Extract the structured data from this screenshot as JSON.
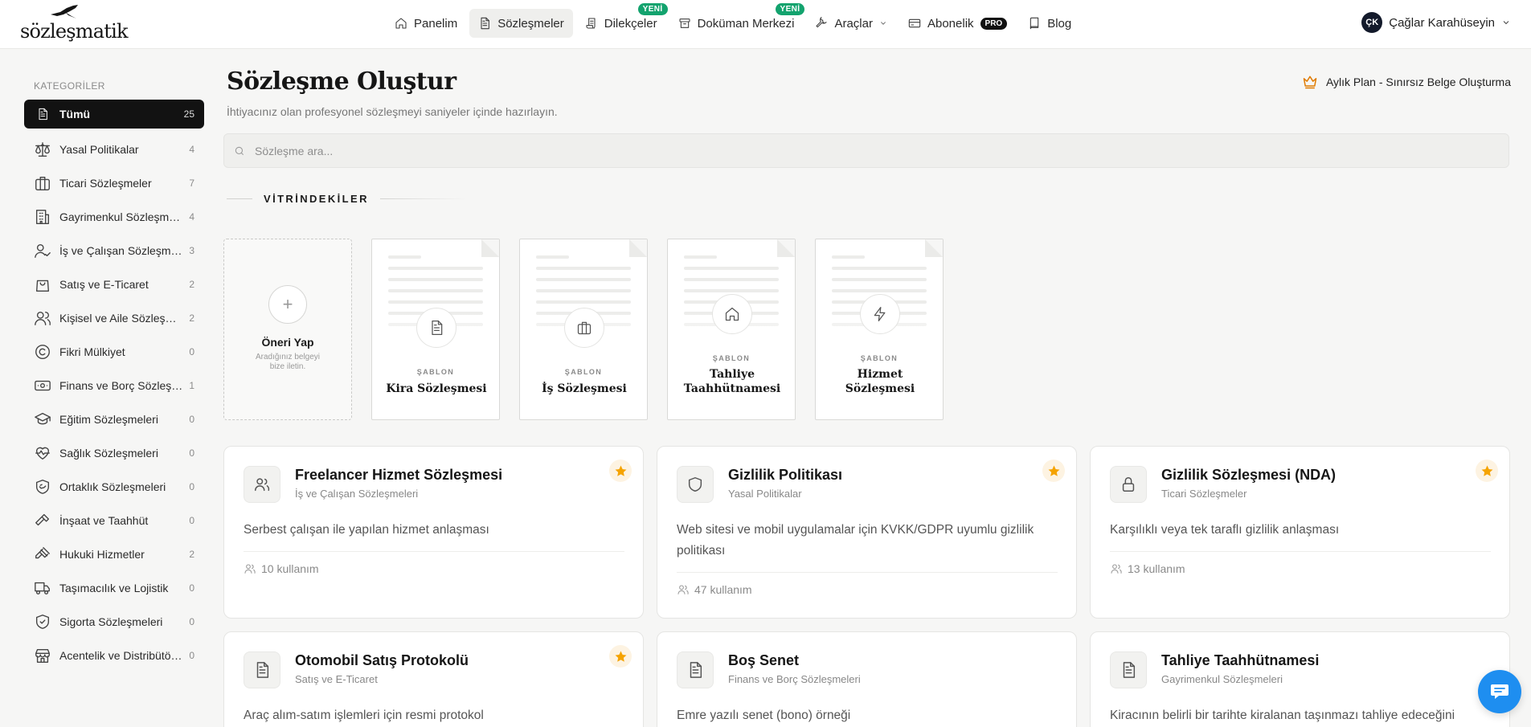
{
  "logo": {
    "text": "sözleşmatik"
  },
  "nav": [
    {
      "label": "Panelim",
      "icon": "home-icon"
    },
    {
      "label": "Sözleşmeler",
      "icon": "document-icon",
      "active": true
    },
    {
      "label": "Dilekçeler",
      "icon": "scroll-icon",
      "badge": "YENİ"
    },
    {
      "label": "Doküman Merkezi",
      "icon": "archive-icon",
      "badge": "YENİ"
    },
    {
      "label": "Araçlar",
      "icon": "wrench-icon",
      "dropdown": true
    },
    {
      "label": "Abonelik",
      "icon": "card-icon",
      "badge": "PRO"
    },
    {
      "label": "Blog",
      "icon": "book-icon"
    }
  ],
  "user": {
    "initials": "ÇK",
    "name": "Çağlar Karahüseyin"
  },
  "sidebar": {
    "title": "KATEGORİLER",
    "items": [
      {
        "label": "Tümü",
        "count": "25",
        "icon": "document-icon"
      },
      {
        "label": "Yasal Politikalar",
        "count": "4",
        "icon": "scale-icon"
      },
      {
        "label": "Ticari Sözleşmeler",
        "count": "7",
        "icon": "briefcase-icon"
      },
      {
        "label": "Gayrimenkul Sözleşmeleri",
        "count": "4",
        "icon": "building-icon"
      },
      {
        "label": "İş ve Çalışan Sözleşmeleri",
        "count": "3",
        "icon": "user-check-icon"
      },
      {
        "label": "Satış ve E-Ticaret",
        "count": "2",
        "icon": "shopping-bag-icon"
      },
      {
        "label": "Kişisel ve Aile Sözleşmeleri",
        "count": "2",
        "icon": "users-icon"
      },
      {
        "label": "Fikri Mülkiyet",
        "count": "0",
        "icon": "copyright-icon"
      },
      {
        "label": "Finans ve Borç Sözleşmeleri",
        "count": "1",
        "icon": "banknote-icon"
      },
      {
        "label": "Eğitim Sözleşmeleri",
        "count": "0",
        "icon": "graduation-cap-icon"
      },
      {
        "label": "Sağlık Sözleşmeleri",
        "count": "0",
        "icon": "heart-pulse-icon"
      },
      {
        "label": "Ortaklık Sözleşmeleri",
        "count": "0",
        "icon": "handshake-shield-icon"
      },
      {
        "label": "İnşaat ve Taahhüt",
        "count": "0",
        "icon": "hammer-icon"
      },
      {
        "label": "Hukuki Hizmetler",
        "count": "2",
        "icon": "gavel-icon"
      },
      {
        "label": "Taşımacılık ve Lojistik",
        "count": "0",
        "icon": "truck-icon"
      },
      {
        "label": "Sigorta Sözleşmeleri",
        "count": "0",
        "icon": "shield-check-icon"
      },
      {
        "label": "Acentelik ve Distribütörlük",
        "count": "0",
        "icon": "store-icon"
      }
    ]
  },
  "main": {
    "title": "Sözleşme Oluştur",
    "subtitle": "İhtiyacınız olan profesyonel sözleşmeyi saniyeler içinde hazırlayın.",
    "plan": "Aylık Plan - Sınırsız Belge Oluşturma",
    "search_placeholder": "Sözleşme ara...",
    "featured_title": "VİTRİNDEKİLER",
    "suggest": {
      "plus": "+",
      "title": "Öneri Yap",
      "desc": "Aradığınız belgeyi bize iletin."
    },
    "templates": [
      {
        "label": "ŞABLON",
        "name": "Kira Sözleşmesi",
        "icon": "file-text-icon"
      },
      {
        "label": "ŞABLON",
        "name": "İş Sözleşmesi",
        "icon": "briefcase-icon"
      },
      {
        "label": "ŞABLON",
        "name": "Tahliye Taahhütnamesi",
        "icon": "home-icon"
      },
      {
        "label": "ŞABLON",
        "name": "Hizmet Sözleşmesi",
        "icon": "zap-icon"
      }
    ],
    "cards": [
      {
        "title": "Freelancer Hizmet Sözleşmesi",
        "category": "İş ve Çalışan Sözleşmeleri",
        "desc": "Serbest çalışan ile yapılan hizmet anlaşması",
        "usage": "10 kullanım",
        "starred": true,
        "icon": "users-icon"
      },
      {
        "title": "Gizlilik Politikası",
        "category": "Yasal Politikalar",
        "desc": "Web sitesi ve mobil uygulamalar için KVKK/GDPR uyumlu gizlilik politikası",
        "usage": "47 kullanım",
        "starred": true,
        "icon": "shield-icon"
      },
      {
        "title": "Gizlilik Sözleşmesi (NDA)",
        "category": "Ticari Sözleşmeler",
        "desc": "Karşılıklı veya tek taraflı gizlilik anlaşması",
        "usage": "13 kullanım",
        "starred": true,
        "icon": "lock-icon"
      },
      {
        "title": "Otomobil Satış Protokolü",
        "category": "Satış ve E-Ticaret",
        "desc": "Araç alım-satım işlemleri için resmi protokol",
        "starred": true,
        "icon": "file-text-icon"
      },
      {
        "title": "Boş Senet",
        "category": "Finans ve Borç Sözleşmeleri",
        "desc": "Emre yazılı senet (bono) örneği",
        "starred": false,
        "icon": "file-text-icon"
      },
      {
        "title": "Tahliye Taahhütnamesi",
        "category": "Gayrimenkul Sözleşmeleri",
        "desc": "Kiracının belirli bir tarihte kiralanan taşınmazı tahliye edeceğini",
        "starred": false,
        "icon": "file-text-icon"
      }
    ]
  },
  "colors": {
    "accent": "#121212",
    "star": "#f5a300",
    "new_badge": "#13a36e",
    "chat": "#1e8ef0",
    "crown": "#e07b00"
  }
}
